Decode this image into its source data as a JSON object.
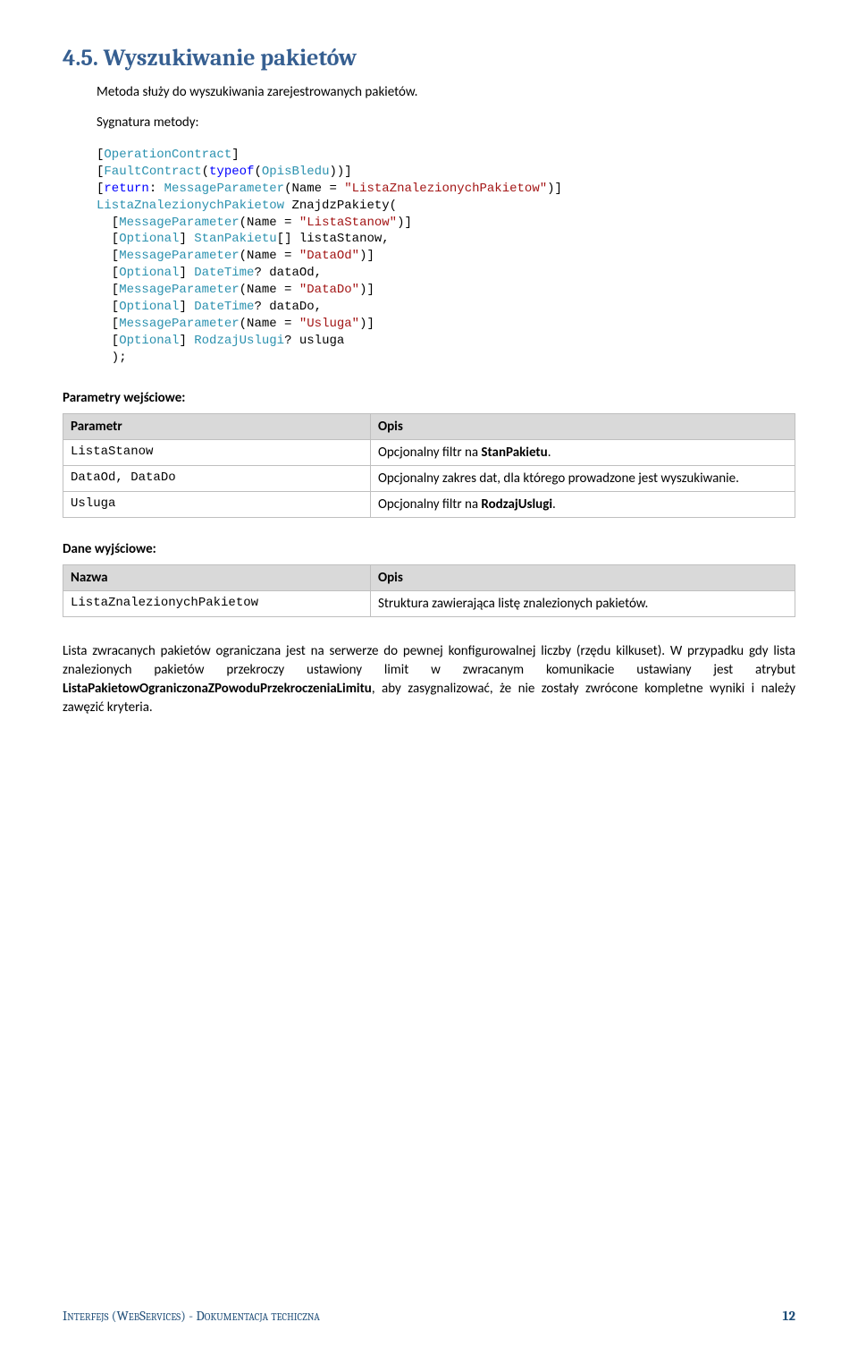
{
  "heading": {
    "number": "4.5.",
    "title": "Wyszukiwanie pakietów"
  },
  "intro": "Metoda służy do wyszukiwania zarejestrowanych pakietów.",
  "signature_label": "Sygnatura metody:",
  "code": {
    "l1a": "[",
    "l1b": "OperationContract",
    "l1c": "]",
    "l2a": "[",
    "l2b": "FaultContract",
    "l2c": "(",
    "l2d": "typeof",
    "l2e": "(",
    "l2f": "OpisBledu",
    "l2g": "))]",
    "l3a": "[",
    "l3b": "return",
    "l3c": ": ",
    "l3d": "MessageParameter",
    "l3e": "(Name = ",
    "l3f": "\"ListaZnalezionychPakietow\"",
    "l3g": ")]",
    "l4a": "ListaZnalezionychPakietow",
    "l4b": " ZnajdzPakiety(",
    "l5a": "  [",
    "l5b": "MessageParameter",
    "l5c": "(Name = ",
    "l5d": "\"ListaStanow\"",
    "l5e": ")]",
    "l6a": "  [",
    "l6b": "Optional",
    "l6c": "] ",
    "l6d": "StanPakietu",
    "l6e": "[] listaStanow,",
    "l7a": "  [",
    "l7b": "MessageParameter",
    "l7c": "(Name = ",
    "l7d": "\"DataOd\"",
    "l7e": ")]",
    "l8a": "  [",
    "l8b": "Optional",
    "l8c": "] ",
    "l8d": "DateTime",
    "l8e": "? dataOd,",
    "l9a": "  [",
    "l9b": "MessageParameter",
    "l9c": "(Name = ",
    "l9d": "\"DataDo\"",
    "l9e": ")]",
    "l10a": "  [",
    "l10b": "Optional",
    "l10c": "] ",
    "l10d": "DateTime",
    "l10e": "? dataDo,",
    "l11a": "  [",
    "l11b": "MessageParameter",
    "l11c": "(Name = ",
    "l11d": "\"Usluga\"",
    "l11e": ")]",
    "l12a": "  [",
    "l12b": "Optional",
    "l12c": "] ",
    "l12d": "RodzajUslugi",
    "l12e": "? usluga",
    "l13": "  );"
  },
  "input_params": {
    "title": "Parametry wejściowe:",
    "headers": {
      "col1": "Parametr",
      "col2": "Opis"
    },
    "rows": [
      {
        "name": "ListaStanow",
        "desc_pre": "Opcjonalny filtr na ",
        "desc_bold": "StanPakietu",
        "desc_post": "."
      },
      {
        "name": "DataOd, DataDo",
        "desc_pre": "Opcjonalny zakres dat, dla którego prowadzone jest wyszukiwanie.",
        "desc_bold": "",
        "desc_post": ""
      },
      {
        "name": "Usluga",
        "desc_pre": "Opcjonalny filtr na ",
        "desc_bold": "RodzajUslugi",
        "desc_post": "."
      }
    ]
  },
  "output_data": {
    "title": "Dane wyjściowe:",
    "headers": {
      "col1": "Nazwa",
      "col2": "Opis"
    },
    "rows": [
      {
        "name": "ListaZnalezionychPakietow",
        "desc": "Struktura zawierająca listę znalezionych pakietów."
      }
    ]
  },
  "paragraph": {
    "p1": "Lista zwracanych pakietów ograniczana jest na serwerze do pewnej konfigurowalnej liczby (rzędu kilkuset). W przypadku gdy lista znalezionych pakietów przekroczy ustawiony limit w zwracanym komunikacie ustawiany jest atrybut ",
    "bold": "ListaPakietowOgraniczonaZPowoduPrzekroczeniaLimitu",
    "p2": ", aby zasygnalizować, że nie zostały zwrócone kompletne wyniki i należy zawęzić kryteria."
  },
  "footer": {
    "left": "Interfejs (WebServices)  -  Dokumentacja techiczna",
    "page": "12"
  }
}
